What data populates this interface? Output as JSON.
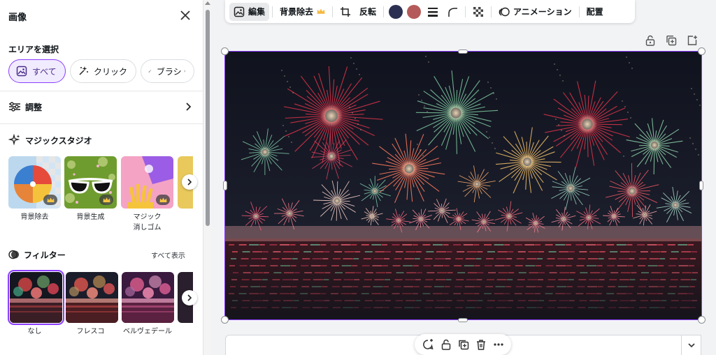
{
  "panel": {
    "title": "画像",
    "area_section": {
      "title": "エリアを選択",
      "options": [
        {
          "label": "すべて",
          "icon": "image-icon",
          "selected": true
        },
        {
          "label": "クリック",
          "icon": "magic-click-icon",
          "selected": false
        },
        {
          "label": "ブラシ",
          "icon": "brush-icon",
          "selected": false
        }
      ]
    },
    "adjust": {
      "label": "調整"
    },
    "magic_studio": {
      "title": "マジックスタジオ",
      "tools": [
        {
          "label": "背景除去",
          "premium": true
        },
        {
          "label": "背景生成",
          "premium": true
        },
        {
          "label": "マジック\n消しゴム",
          "premium": true
        }
      ]
    },
    "filters": {
      "title": "フィルター",
      "see_all": "すべて表示",
      "items": [
        {
          "label": "なし",
          "selected": true
        },
        {
          "label": "フレスコ",
          "selected": false
        },
        {
          "label": "ベルヴェデール",
          "selected": false
        }
      ]
    }
  },
  "toolbar": {
    "edit": "編集",
    "bg_remove": "背景除去",
    "flip": "反転",
    "colors": [
      "#2b2f52",
      "#b55a5a"
    ],
    "animate": "アニメーション",
    "position": "配置"
  },
  "icons": {
    "canvas_top": [
      "lock-icon",
      "duplicate-page-icon",
      "add-page-icon"
    ],
    "float_bar": [
      "comment-add-icon",
      "lock-icon",
      "duplicate-icon",
      "trash-icon",
      "more-icon"
    ]
  },
  "colors": {
    "accent": "#8b3dff"
  }
}
